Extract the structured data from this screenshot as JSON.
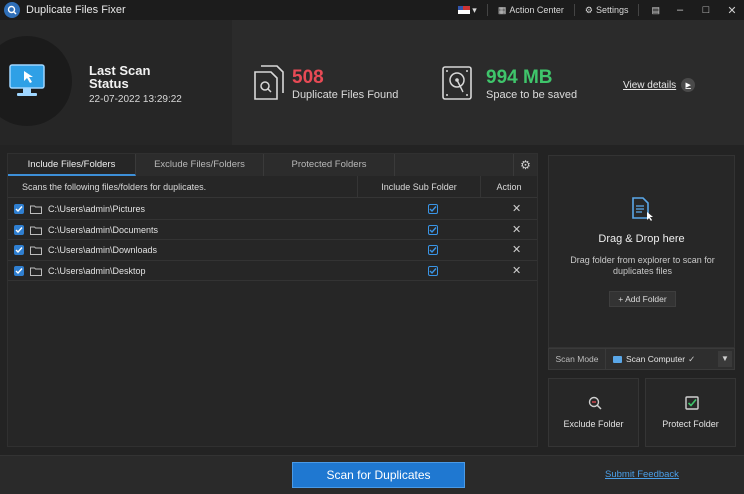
{
  "titlebar": {
    "title": "Duplicate Files Fixer",
    "action_center": "Action Center",
    "settings": "Settings",
    "window_buttons": [
      "–",
      "□",
      "✕"
    ]
  },
  "header": {
    "last_scan_title": "Last Scan Status",
    "last_scan_date": "22-07-2022 13:29:22",
    "duplicates_count": "508",
    "duplicates_label": "Duplicate Files Found",
    "space_value": "994 MB",
    "space_label": "Space to be saved",
    "view_details": "View details",
    "colors": {
      "duplicates": "#e84a55",
      "space": "#3fc56b"
    }
  },
  "tabs": [
    {
      "label": "Include Files/Folders",
      "active": true
    },
    {
      "label": "Exclude Files/Folders",
      "active": false
    },
    {
      "label": "Protected Folders",
      "active": false
    }
  ],
  "table": {
    "header_path": "Scans the following files/folders for duplicates.",
    "header_sub": "Include Sub Folder",
    "header_action": "Action",
    "rows": [
      {
        "path": "C:\\Users\\admin\\Pictures",
        "selected": true,
        "include_sub": true
      },
      {
        "path": "C:\\Users\\admin\\Documents",
        "selected": true,
        "include_sub": true
      },
      {
        "path": "C:\\Users\\admin\\Downloads",
        "selected": true,
        "include_sub": true
      },
      {
        "path": "C:\\Users\\admin\\Desktop",
        "selected": true,
        "include_sub": true
      }
    ]
  },
  "drop": {
    "title": "Drag & Drop here",
    "description": "Drag folder from explorer to scan for duplicates files",
    "add_folder": "+ Add Folder"
  },
  "scan_mode": {
    "label": "Scan Mode",
    "value": "Scan Computer",
    "check": "✓"
  },
  "tiles": {
    "exclude": "Exclude Folder",
    "protect": "Protect Folder"
  },
  "footer": {
    "scan_button": "Scan for Duplicates",
    "feedback": "Submit Feedback"
  },
  "accent_color": "#1f78d1"
}
